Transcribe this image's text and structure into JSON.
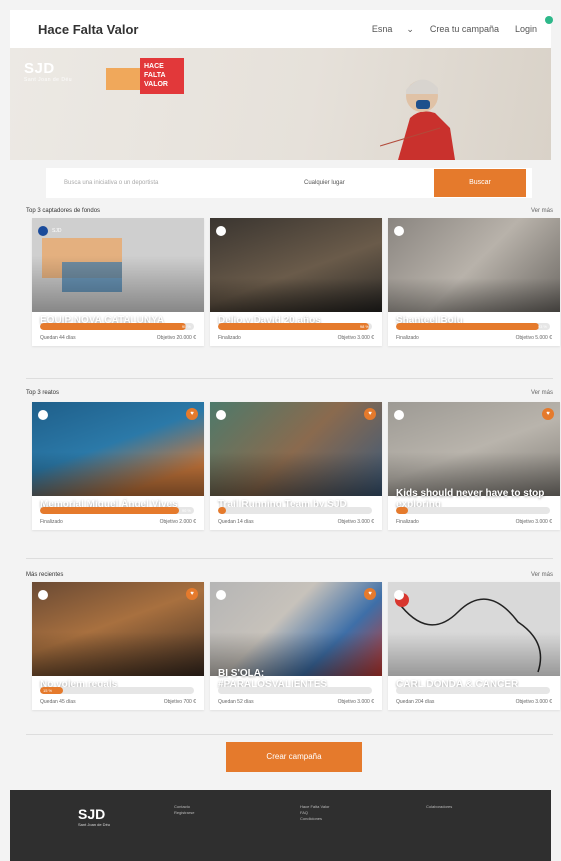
{
  "header": {
    "brand": "Hace Falta Valor",
    "language": "Esna",
    "create_link": "Crea tu campaña",
    "login": "Login"
  },
  "hero": {
    "org_logo": "SJD",
    "org_sub": "Sant Joan de Déu",
    "campaign_logo": "HACE FALTA VALOR"
  },
  "search": {
    "placeholder": "Busca una iniciativa o un deportista",
    "location": "Cualquier lugar",
    "button": "Buscar"
  },
  "sections": [
    {
      "title": "Top 3 captadores de fondos",
      "more": "Ver más",
      "cards": [
        {
          "org": "SJD",
          "title": "EQUIP NOVA CATALUNYA",
          "subtitle": "",
          "progress": 0.95,
          "pct_label": "95 %",
          "meta_left": "Quedan 44 días",
          "meta_right": "Objetivo 20.000 €"
        },
        {
          "org": "",
          "title": "Delio y David 20 años",
          "subtitle": "",
          "progress": 0.98,
          "pct_label": "98 %",
          "meta_left": "Finalizado",
          "meta_right": "Objetivo 3.000 €"
        },
        {
          "org": "",
          "title": "Shanteel Bolu",
          "subtitle": "",
          "progress": 0.93,
          "pct_label": "93 %",
          "meta_left": "Finalizado",
          "meta_right": "Objetivo 5.000 €"
        }
      ]
    },
    {
      "title": "Top 3 reatos",
      "more": "Ver más",
      "cards": [
        {
          "org": "",
          "title": "Memorial Miguel Ángel Vives",
          "subtitle": "",
          "progress": 0.9,
          "pct_label": "90 %",
          "meta_left": "Finalizado",
          "meta_right": "Objetivo 2.000 €"
        },
        {
          "org": "",
          "title": "Trail Running Team by SJD",
          "subtitle": "",
          "progress": 0.05,
          "pct_label": "5 %",
          "meta_left": "Quedan 14 días",
          "meta_right": "Objetivo 3.000 €"
        },
        {
          "org": "",
          "title": "Kids should never have to stop exploring",
          "subtitle": "",
          "progress": 0.08,
          "pct_label": "8 %",
          "meta_left": "Finalizado",
          "meta_right": "Objetivo 3.000 €"
        }
      ]
    },
    {
      "title": "Más recientes",
      "more": "Ver más",
      "cards": [
        {
          "org": "",
          "title": "No volem regals",
          "subtitle": "",
          "progress": 0.15,
          "pct_label": "15 %",
          "meta_left": "Quedan 45 días",
          "meta_right": "Objetivo 700 €"
        },
        {
          "org": "",
          "title": "BI S'OLA: #PARALOSVALIENTES",
          "subtitle": "",
          "progress": 0.0,
          "pct_label": "",
          "meta_left": "Quedan 52 días",
          "meta_right": "Objetivo 3.000 €"
        },
        {
          "org": "",
          "title": "CARL DONDA & CANCER",
          "subtitle": "",
          "progress": 0.0,
          "pct_label": "",
          "meta_left": "Quedan 204 días",
          "meta_right": "Objetivo 3.000 €"
        }
      ]
    }
  ],
  "cta": "Crear campaña",
  "footer": {
    "logo": "SJD",
    "logo_sub": "Sant Joan de Déu",
    "col1": [
      "Contacto",
      "Registrarse"
    ],
    "col2": [
      "Hace Falta Valor",
      "FAQ",
      "Condiciones"
    ],
    "col3": [
      "Colaboradores"
    ]
  },
  "colors": {
    "accent": "#e57a2c",
    "footer": "#2f2f2f"
  }
}
